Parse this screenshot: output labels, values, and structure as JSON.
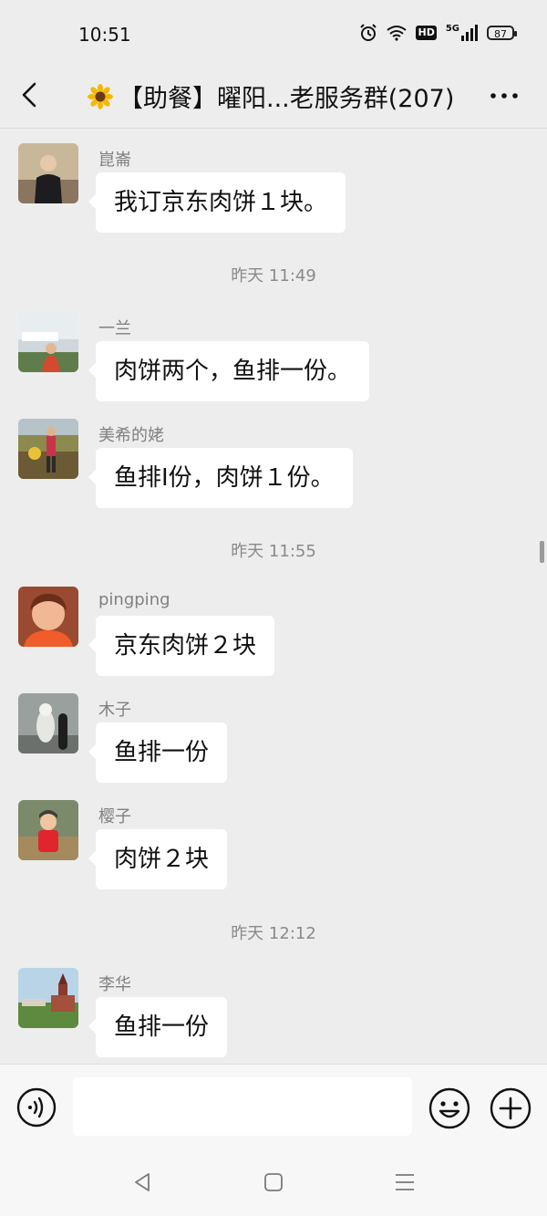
{
  "status_bar": {
    "time": "10:51",
    "network": "5G",
    "hd": "HD",
    "battery": "87"
  },
  "header": {
    "title": "【助餐】曜阳...老服务群(207)"
  },
  "messages": [
    {
      "sender": "崑崙",
      "text": "我订京东肉饼１块。"
    },
    {
      "sender": "一兰",
      "text": "肉饼两个，鱼排一份。"
    },
    {
      "sender": "美希的姥",
      "text": "鱼排Ⅰ份，肉饼１份。"
    },
    {
      "sender": "pingping",
      "text": "京东肉饼２块"
    },
    {
      "sender": "木子",
      "text": "鱼排一份"
    },
    {
      "sender": "樱子",
      "text": "肉饼２块"
    },
    {
      "sender": "李华",
      "text": "鱼排一份"
    }
  ],
  "time_separators": [
    "昨天 11:49",
    "昨天 11:55",
    "昨天 12:12"
  ],
  "input": {
    "value": "",
    "placeholder": ""
  },
  "icons": {
    "back": "chevron-left-icon",
    "more": "more-dots-icon",
    "voice": "voice-icon",
    "emoji": "emoji-icon",
    "plus": "plus-icon"
  },
  "colors": {
    "background": "#ededed",
    "bubble": "#ffffff",
    "sender": "#808080"
  }
}
